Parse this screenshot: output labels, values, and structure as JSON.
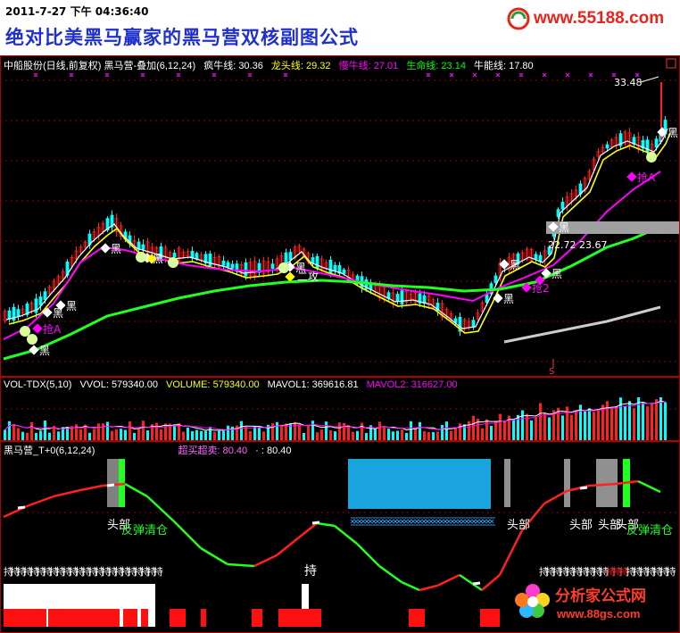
{
  "banner": {
    "timestamp": "2011-7-27 下午 04:36:40",
    "title": "绝对比美黑马赢家的黑马营双核副图公式",
    "site": "www.55188.com"
  },
  "watermark": {
    "name": "分析家公式网",
    "url": "www.88gs.com"
  },
  "main_panel": {
    "header": "中船股份(日线,前复权) 黑马营-叠加(6,12,24)",
    "lines": [
      {
        "label": "疯牛线: 30.36",
        "color": "#ffffff"
      },
      {
        "label": "龙头线: 29.32",
        "color": "#ffff00"
      },
      {
        "label": "慢牛线: 27.01",
        "color": "#ff00ff"
      },
      {
        "label": "生命线: 23.14",
        "color": "#00ff00"
      },
      {
        "label": "牛能线: 17.80",
        "color": "#ffffff"
      }
    ],
    "annotations": {
      "high": "33.48",
      "box_low": "22.72",
      "box_high": "23.67",
      "hei": "黑",
      "qiang": "抢A",
      "qiang2": "抢2",
      "er_gong": "二攻",
      "s": "S"
    }
  },
  "volume_panel": {
    "header": "VOL-TDX(5,10)",
    "values": [
      {
        "label": "VVOL: 579340.00",
        "color": "#ffffff"
      },
      {
        "label": "VOLUME: 579340.00",
        "color": "#ffff00"
      },
      {
        "label": "MAVOL1: 369616.81",
        "color": "#ffffff"
      },
      {
        "label": "MAVOL2: 316627.00",
        "color": "#ff00ff"
      }
    ]
  },
  "osc_panel": {
    "header": "黑马营_T+0(6,12,24)",
    "value1": "超买超卖: 80.40",
    "value2": "· : 80.40",
    "labels": {
      "top1": "头部",
      "top2": "头部",
      "top3": "头部",
      "overlap1": "头部",
      "overlap2": "头部",
      "clear": "反弹清仓",
      "hold": "持"
    }
  },
  "colors": {
    "up": "#ff2020",
    "down": "#00ffff",
    "grid": "#8b0000",
    "border": "#b00000"
  },
  "chart_data": [
    {
      "type": "line",
      "title": "中船股份(日线,前复权)",
      "series": [
        {
          "name": "疯牛线",
          "last": 30.36
        },
        {
          "name": "龙头线",
          "last": 29.32
        },
        {
          "name": "慢牛线",
          "last": 27.01
        },
        {
          "name": "生命线",
          "last": 23.14
        },
        {
          "name": "牛能线",
          "last": 17.8
        }
      ],
      "annotations": [
        33.48,
        22.72,
        23.67
      ]
    },
    {
      "type": "bar",
      "title": "VOL-TDX(5,10)",
      "series": [
        {
          "name": "VVOL",
          "last": 579340.0
        },
        {
          "name": "VOLUME",
          "last": 579340.0
        },
        {
          "name": "MAVOL1",
          "last": 369616.81
        },
        {
          "name": "MAVOL2",
          "last": 316627.0
        }
      ]
    },
    {
      "type": "line",
      "title": "黑马营_T+0(6,12,24)",
      "series": [
        {
          "name": "超买超卖",
          "last": 80.4
        }
      ]
    }
  ]
}
